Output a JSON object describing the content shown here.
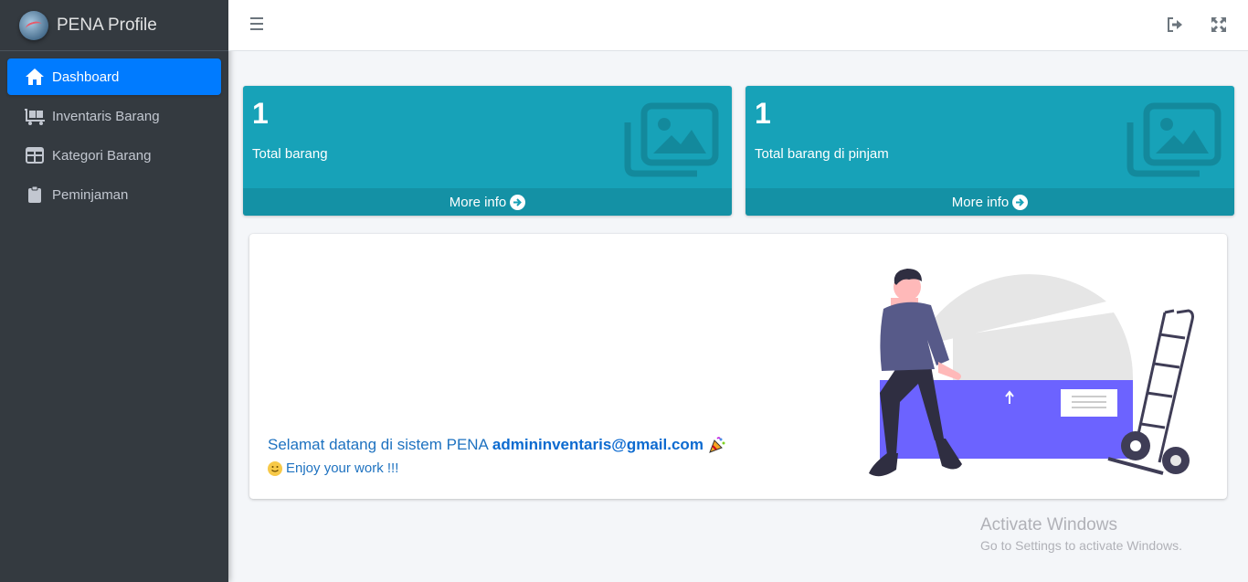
{
  "brand": {
    "name": "PENA Profile"
  },
  "sidebar": {
    "items": [
      {
        "label": "Dashboard",
        "icon": "home-icon",
        "active": true
      },
      {
        "label": "Inventaris Barang",
        "icon": "dolly-flatbed-icon",
        "active": false
      },
      {
        "label": "Kategori Barang",
        "icon": "table-grid-icon",
        "active": false
      },
      {
        "label": "Peminjaman",
        "icon": "clipboard-icon",
        "active": false
      }
    ]
  },
  "navbar": {
    "menu_icon": "hamburger-icon",
    "right_icons": [
      "logout-icon",
      "fullscreen-icon"
    ]
  },
  "stats": [
    {
      "value": "1",
      "label": "Total barang",
      "footer": "More info",
      "icon": "image-icon",
      "color": "#17a2b8"
    },
    {
      "value": "1",
      "label": "Total barang di pinjam",
      "footer": "More info",
      "icon": "image-icon",
      "color": "#17a2b8"
    }
  ],
  "welcome": {
    "text": "Selamat datang di sistem PENA",
    "user": "admininventaris@gmail.com",
    "enjoy": "Enjoy your work !!!"
  },
  "watermark": {
    "title": "Activate Windows",
    "subtitle": "Go to Settings to activate Windows."
  },
  "colors": {
    "sidebar_bg": "#343a40",
    "primary": "#007bff",
    "info": "#17a2b8",
    "content_bg": "#f4f6f9",
    "illustration_accent": "#6c63ff"
  }
}
